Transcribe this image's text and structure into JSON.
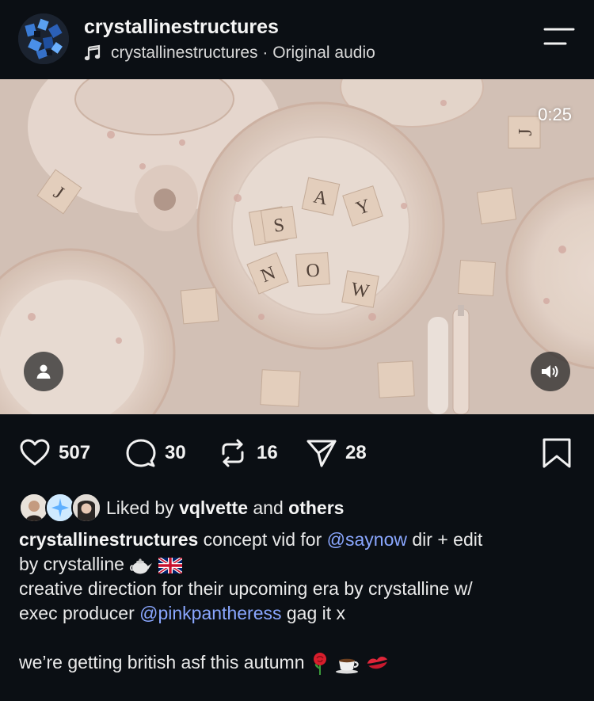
{
  "post": {
    "username": "crystallinestructures",
    "audio_text": "crystallinestructures · Original audio",
    "menu_icon": "menu-icon"
  },
  "video": {
    "timestamp": "0:25",
    "tiles_text": [
      "S",
      "A",
      "Y",
      "N",
      "O",
      "W",
      "J",
      "J"
    ],
    "user_tag_icon": "person-icon",
    "sound_icon": "speaker-icon"
  },
  "actions": {
    "likes": "507",
    "comments": "30",
    "reposts": "16",
    "shares": "28"
  },
  "liked_by": {
    "prefix": "Liked by",
    "user": "vqlvette",
    "conj": "and",
    "others": "others"
  },
  "caption": {
    "author": "crystallinestructures",
    "line1_text": "concept vid for",
    "mention1": "@saynow",
    "line1_rest": "dir + edit",
    "line2_text": "by crystalline",
    "line3_text": "creative direction for their upcoming era by crystalline w/",
    "line4_text": "exec producer",
    "mention2": "@pinkpantheress",
    "line4_rest": "gag it x",
    "line5_text": "we’re getting british asf this autumn",
    "emojis_line2": [
      "teapot",
      "uk-flag"
    ],
    "emojis_line5": [
      "rose",
      "coffee",
      "kiss"
    ]
  },
  "colors": {
    "background": "#0b0f14",
    "text": "#f2f2f2",
    "mention": "#8aa7ff",
    "video_tone": "#d7c6bc"
  }
}
